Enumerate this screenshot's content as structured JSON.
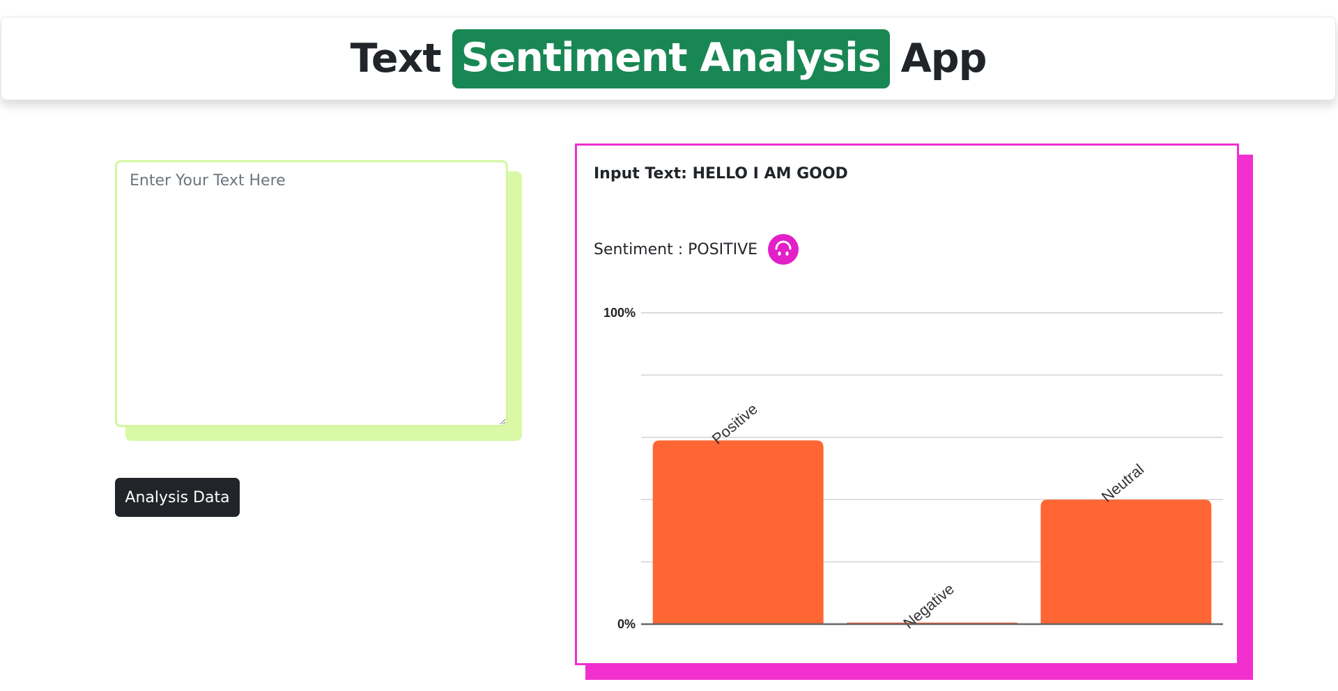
{
  "header": {
    "title_prefix": "Text",
    "title_highlight": "Sentiment Analysis",
    "title_suffix": "App",
    "highlight_color": "#198754"
  },
  "input_panel": {
    "placeholder": "Enter Your Text Here",
    "value": "",
    "button_label": "Analysis Data"
  },
  "result": {
    "input_text": "Input Text: HELLO I AM GOOD",
    "sentiment": "Sentiment : POSITIVE",
    "sentiment_icon": "upside-down-face-icon",
    "accent_color": "#ef2fd0"
  },
  "chart_data": {
    "type": "bar",
    "categories": [
      "Positive",
      "Negative",
      "Neutral"
    ],
    "values": [
      59,
      0.5,
      40
    ],
    "unit": "%",
    "ylim": [
      0,
      100
    ],
    "ytick_labels": [
      "0%",
      "100%"
    ],
    "gridlines": 5,
    "bar_color": "#ff6633",
    "grid": true,
    "legend": "none"
  }
}
